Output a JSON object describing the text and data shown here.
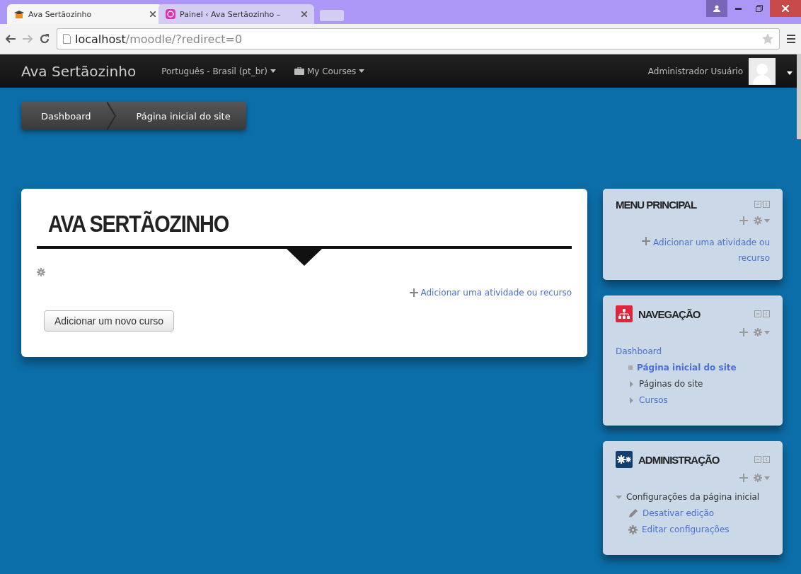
{
  "browser": {
    "tabs": [
      {
        "title": "Ava Sertãozinho",
        "selected": true
      },
      {
        "title": "Painel ‹ Ava Sertãozinho –",
        "selected": false
      }
    ],
    "url": {
      "host": "localhost",
      "path": "/moodle/?redirect=0"
    }
  },
  "navbar": {
    "brand": "Ava Sertãozinho",
    "menus": [
      {
        "label": "Português - Brasil (pt_br)"
      },
      {
        "label": "My Courses"
      }
    ],
    "user": "Administrador Usuário"
  },
  "breadcrumb": [
    {
      "label": "Dashboard"
    },
    {
      "label": "Página inicial do site"
    }
  ],
  "main": {
    "title": "AVA SERTÃOZINHO",
    "add_activity": "Adicionar uma atividade ou recurso",
    "add_course": "Adicionar um novo curso"
  },
  "blocks": [
    {
      "title": "MENU PRINCIPAL",
      "add_activity": "Adicionar uma atividade ou recurso"
    },
    {
      "title": "NAVEGAÇÃO",
      "items": [
        {
          "label": "Dashboard",
          "kind": "link",
          "children": [
            {
              "label": "Página inicial do site",
              "kind": "current"
            },
            {
              "label": "Páginas do site",
              "kind": "text",
              "expanded": false
            },
            {
              "label": "Cursos",
              "kind": "link",
              "expanded": false
            }
          ]
        }
      ]
    },
    {
      "title": "ADMINISTRAÇÃO",
      "items": [
        {
          "label": "Configurações da página inicial",
          "kind": "text",
          "expanded": true,
          "children": [
            {
              "label": "Desativar edição",
              "kind": "link"
            },
            {
              "label": "Editar configurações",
              "kind": "link"
            }
          ]
        }
      ]
    }
  ]
}
